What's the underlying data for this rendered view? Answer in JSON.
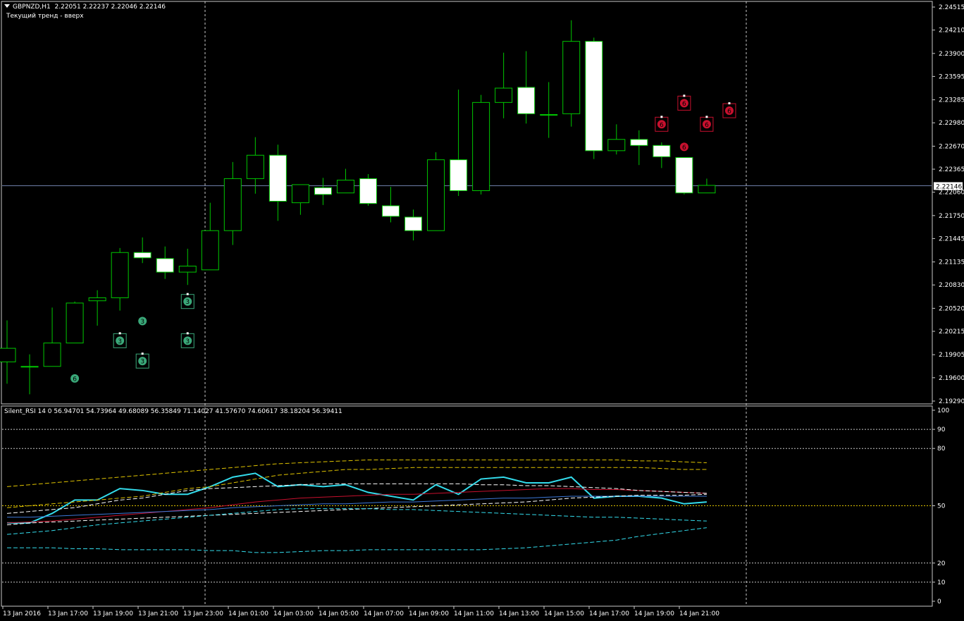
{
  "header": {
    "symbol": "GBPNZD,H1",
    "ohlc": "2.22051 2.22237 2.22046 2.22146",
    "trend_text": "Текущий тренд - вверх"
  },
  "rsi_header": "Silent_RSI 14 0 56.94701 54.73964 49.68089 56.35849 71.14027 41.57670 74.60617 38.18204 56.39411",
  "current_price_label": "2.22146",
  "colors": {
    "background": "#000000",
    "grid": "#c8c8c8",
    "candle_border": "#00c800",
    "candle_body": "#ffffff",
    "bid_line": "#6e7ea8",
    "rsi_main": "#33dcec",
    "signal_green": "#3aa879",
    "signal_red": "#c8102e"
  },
  "chart_data": [
    {
      "type": "candlestick",
      "title": "GBPNZD,H1",
      "ylim": [
        2.1929,
        2.24515
      ],
      "y_ticks": [
        "2.24515",
        "2.24210",
        "2.23900",
        "2.23595",
        "2.23285",
        "2.22980",
        "2.22670",
        "2.22365",
        "2.22060",
        "2.21750",
        "2.21445",
        "2.21135",
        "2.20830",
        "2.20520",
        "2.20215",
        "2.19905",
        "2.19600",
        "2.19290"
      ],
      "current_price": 2.22146,
      "x_labels": [
        "13 Jan 2016",
        "13 Jan 17:00",
        "13 Jan 19:00",
        "13 Jan 21:00",
        "13 Jan 23:00",
        "14 Jan 01:00",
        "14 Jan 03:00",
        "14 Jan 05:00",
        "14 Jan 07:00",
        "14 Jan 09:00",
        "14 Jan 11:00",
        "14 Jan 13:00",
        "14 Jan 15:00",
        "14 Jan 17:00",
        "14 Jan 19:00",
        "14 Jan 21:00"
      ],
      "candles": [
        {
          "o": 2.1981,
          "h": 2.2036,
          "l": 2.1952,
          "c": 2.1999
        },
        {
          "o": 2.1975,
          "h": 2.1991,
          "l": 2.1938,
          "c": 2.1975
        },
        {
          "o": 2.1975,
          "h": 2.2053,
          "l": 2.1975,
          "c": 2.2006
        },
        {
          "o": 2.2006,
          "h": 2.2061,
          "l": 2.2006,
          "c": 2.2059
        },
        {
          "o": 2.2062,
          "h": 2.2076,
          "l": 2.2029,
          "c": 2.2066
        },
        {
          "o": 2.2066,
          "h": 2.2132,
          "l": 2.2049,
          "c": 2.2126
        },
        {
          "o": 2.2126,
          "h": 2.2146,
          "l": 2.2112,
          "c": 2.2119
        },
        {
          "o": 2.2118,
          "h": 2.2134,
          "l": 2.2091,
          "c": 2.21
        },
        {
          "o": 2.21,
          "h": 2.2131,
          "l": 2.2083,
          "c": 2.2108
        },
        {
          "o": 2.2103,
          "h": 2.2192,
          "l": 2.2103,
          "c": 2.2155
        },
        {
          "o": 2.2155,
          "h": 2.2246,
          "l": 2.2136,
          "c": 2.2224
        },
        {
          "o": 2.2224,
          "h": 2.2279,
          "l": 2.2204,
          "c": 2.2255
        },
        {
          "o": 2.2255,
          "h": 2.2269,
          "l": 2.2168,
          "c": 2.2194
        },
        {
          "o": 2.2192,
          "h": 2.2215,
          "l": 2.2176,
          "c": 2.2216
        },
        {
          "o": 2.2212,
          "h": 2.2225,
          "l": 2.2189,
          "c": 2.2203
        },
        {
          "o": 2.2205,
          "h": 2.2237,
          "l": 2.2205,
          "c": 2.2222
        },
        {
          "o": 2.2224,
          "h": 2.223,
          "l": 2.2188,
          "c": 2.2191
        },
        {
          "o": 2.2188,
          "h": 2.2213,
          "l": 2.2166,
          "c": 2.2174
        },
        {
          "o": 2.2173,
          "h": 2.2183,
          "l": 2.2142,
          "c": 2.2155
        },
        {
          "o": 2.2155,
          "h": 2.2259,
          "l": 2.2155,
          "c": 2.2249
        },
        {
          "o": 2.2249,
          "h": 2.2342,
          "l": 2.2201,
          "c": 2.2208
        },
        {
          "o": 2.2208,
          "h": 2.2335,
          "l": 2.2203,
          "c": 2.2325
        },
        {
          "o": 2.2325,
          "h": 2.2391,
          "l": 2.2304,
          "c": 2.2344
        },
        {
          "o": 2.2345,
          "h": 2.2393,
          "l": 2.2297,
          "c": 2.231
        },
        {
          "o": 2.2309,
          "h": 2.2352,
          "l": 2.2278,
          "c": 2.2309
        },
        {
          "o": 2.231,
          "h": 2.2434,
          "l": 2.2293,
          "c": 2.2406
        },
        {
          "o": 2.2406,
          "h": 2.2411,
          "l": 2.225,
          "c": 2.2261
        },
        {
          "o": 2.2261,
          "h": 2.2296,
          "l": 2.2256,
          "c": 2.2276
        },
        {
          "o": 2.2276,
          "h": 2.2288,
          "l": 2.2242,
          "c": 2.2268
        },
        {
          "o": 2.2268,
          "h": 2.2272,
          "l": 2.2238,
          "c": 2.2253
        },
        {
          "o": 2.2252,
          "h": 2.2252,
          "l": 2.2203,
          "c": 2.2205
        },
        {
          "o": 2.2205,
          "h": 2.2224,
          "l": 2.2205,
          "c": 2.2215
        }
      ],
      "signals_green": [
        {
          "bar": 3,
          "price": 2.196,
          "label": "6",
          "boxed": false
        },
        {
          "bar": 5,
          "price": 2.201,
          "label": "3",
          "boxed": true
        },
        {
          "bar": 6,
          "price": 2.2036,
          "label": "3",
          "boxed": false
        },
        {
          "bar": 6,
          "price": 2.1983,
          "label": "3",
          "boxed": true
        },
        {
          "bar": 8,
          "price": 2.201,
          "label": "3",
          "boxed": true
        },
        {
          "bar": 8,
          "price": 2.2062,
          "label": "3",
          "boxed": true
        }
      ],
      "signals_red": [
        {
          "bar": 29,
          "price": 2.2297,
          "label": "6",
          "boxed": true
        },
        {
          "bar": 30,
          "price": 2.2325,
          "label": "6",
          "boxed": true
        },
        {
          "bar": 30,
          "price": 2.2267,
          "label": "6",
          "boxed": false
        },
        {
          "bar": 31,
          "price": 2.2297,
          "label": "6",
          "boxed": true
        },
        {
          "bar": 32,
          "price": 2.2315,
          "label": "6",
          "boxed": true
        }
      ]
    },
    {
      "type": "line",
      "title": "Silent_RSI 14 0 56.94701 54.73964 49.68089 56.35849 71.14027 41.57670 74.60617 38.18204 56.39411",
      "ylim": [
        0,
        100
      ],
      "y_ticks": [
        "100",
        "90",
        "80",
        "50",
        "20",
        "10",
        "0"
      ],
      "levels": [
        90,
        80,
        50,
        20,
        10
      ],
      "series": [
        {
          "key": "rsi",
          "color": "#33dcec",
          "style": "solid",
          "width": 2,
          "values": [
            41,
            41,
            46,
            53,
            53,
            59,
            58,
            56,
            56,
            60,
            65,
            67,
            60,
            61,
            60,
            61,
            57,
            55,
            53,
            61,
            56,
            64,
            65,
            62,
            62,
            65,
            54,
            55,
            55,
            54,
            51,
            52
          ]
        },
        {
          "key": "ma_red",
          "color": "#c8102e",
          "style": "solid",
          "width": 1,
          "values": [
            41,
            41.5,
            42,
            43,
            44,
            45,
            46,
            47,
            48,
            49,
            50.5,
            52,
            53,
            54,
            54.5,
            55,
            55.5,
            56,
            56,
            56.5,
            57,
            57.5,
            58,
            58.5,
            59,
            59,
            58.5,
            58.5,
            58,
            57.5,
            57,
            56.5
          ]
        },
        {
          "key": "ma_blue",
          "color": "#3c78d8",
          "style": "solid",
          "width": 1,
          "values": [
            44,
            44,
            44.5,
            45,
            45.5,
            46,
            46.5,
            47,
            47.5,
            48,
            49,
            49.5,
            50,
            50.5,
            51,
            51,
            51.5,
            52,
            52,
            52.5,
            53,
            53.5,
            54,
            54,
            54.5,
            55,
            55,
            55,
            55,
            55,
            55,
            55
          ]
        },
        {
          "key": "band_yellow_upper",
          "color": "#e0c400",
          "style": "dashed",
          "width": 1,
          "values": [
            60,
            61,
            62,
            63,
            64,
            65,
            66,
            67,
            68,
            69,
            70,
            71,
            72,
            72.5,
            73,
            73.5,
            74,
            74,
            74,
            74,
            74,
            74,
            74,
            74,
            74,
            74,
            74,
            74,
            73.5,
            73.5,
            73,
            72.5
          ]
        },
        {
          "key": "band_yellow_lower",
          "color": "#e0c400",
          "style": "dashed",
          "width": 1,
          "values": [
            49,
            50,
            51,
            52,
            53,
            54,
            55,
            57,
            59,
            60,
            62,
            64,
            66,
            67,
            68,
            69,
            69,
            69.5,
            70,
            70,
            70,
            70,
            70,
            70,
            70,
            70,
            70,
            70,
            70,
            69.5,
            69,
            69
          ]
        },
        {
          "key": "band_white_upper",
          "color": "#ffffff",
          "style": "dashed",
          "width": 1,
          "values": [
            46,
            47,
            48,
            49,
            51,
            53,
            54,
            56,
            58,
            59,
            59.5,
            60,
            60.5,
            61,
            61.5,
            61.5,
            61.5,
            61.5,
            61.5,
            61.5,
            61.5,
            61,
            61,
            60.5,
            60.5,
            60,
            59.5,
            59,
            58,
            57.5,
            57,
            56.5
          ]
        },
        {
          "key": "band_white_lower",
          "color": "#ffffff",
          "style": "dashed",
          "width": 1,
          "values": [
            40,
            41,
            41.5,
            42,
            42.5,
            43,
            43.5,
            44,
            44.5,
            45,
            45.5,
            46,
            46.5,
            47,
            47.5,
            48,
            48.5,
            49,
            49.5,
            50,
            50.5,
            51,
            51.5,
            52,
            53,
            54,
            54.5,
            55,
            55.5,
            55.5,
            55.5,
            56
          ]
        },
        {
          "key": "band_cyan_upper",
          "color": "#33dcec",
          "style": "dashed",
          "width": 1,
          "values": [
            35,
            36,
            37,
            38.5,
            40,
            41,
            42,
            43,
            44,
            45,
            46,
            47,
            48,
            48.5,
            48.5,
            48.5,
            48.5,
            48,
            48,
            47.5,
            47,
            46.5,
            46,
            45.5,
            45,
            44.5,
            44,
            44,
            43.5,
            43,
            42.5,
            42
          ]
        },
        {
          "key": "band_cyan_lower",
          "color": "#33dcec",
          "style": "dashed",
          "width": 1,
          "values": [
            28,
            28,
            28,
            27.5,
            27.5,
            27,
            27,
            27,
            27,
            26.5,
            26.5,
            25.5,
            25.5,
            26,
            26.5,
            26.5,
            27,
            27,
            27,
            27,
            27,
            27,
            27.5,
            28,
            29,
            30,
            31,
            32,
            34,
            35.5,
            37,
            38.5
          ]
        }
      ]
    }
  ]
}
